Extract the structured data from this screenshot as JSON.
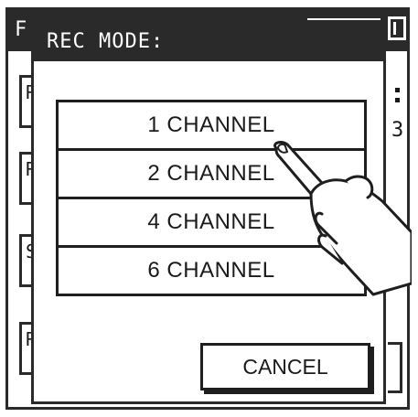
{
  "background": {
    "title_letter": "F",
    "row_letters": [
      "R",
      "R",
      "S",
      "R"
    ],
    "right_digit": "3"
  },
  "dialog": {
    "title": "REC MODE:",
    "options": [
      {
        "label": "1 CHANNEL"
      },
      {
        "label": "2 CHANNEL"
      },
      {
        "label": "4 CHANNEL"
      },
      {
        "label": "6 CHANNEL"
      }
    ],
    "cancel_label": "CANCEL"
  },
  "colors": {
    "titlebar": "#2a2a2a",
    "line": "#1e1e1e",
    "background": "#ffffff"
  },
  "icons": {
    "pointer": "pointing-hand-icon",
    "close": "close-icon"
  }
}
